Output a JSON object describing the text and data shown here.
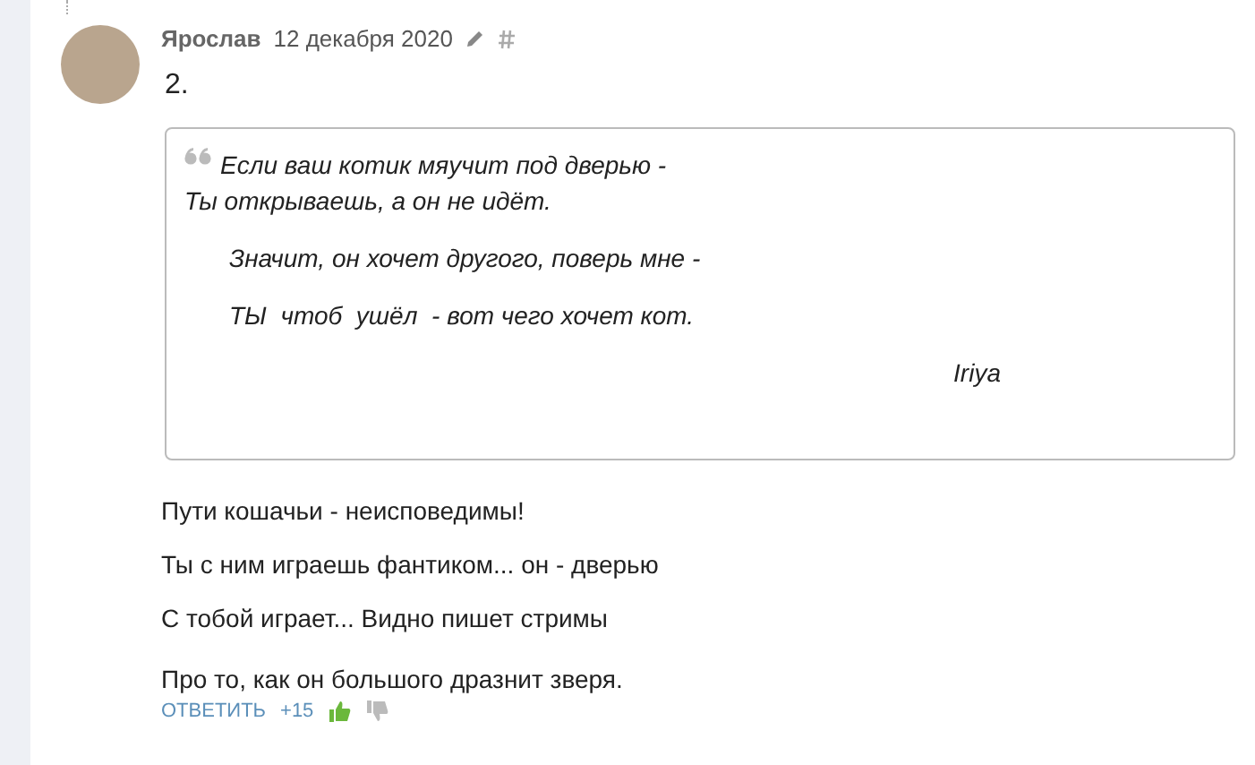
{
  "comment": {
    "author": "Ярослав",
    "date": "12 декабря 2020",
    "number": "2.",
    "quote": {
      "lines": [
        {
          "text": "Если ваш котик мяучит под дверью -",
          "kind": "first"
        },
        {
          "text": "Ты открываешь, а он не идёт.",
          "kind": "plain"
        },
        {
          "text": "Значит, он хочет другого, поверь мне -",
          "kind": "indent"
        },
        {
          "text": "ТЫ  чтоб  ушёл  - вот чего хочет кот.",
          "kind": "indent"
        }
      ],
      "signature": "Iriya"
    },
    "paragraphs": [
      "Пути кошачьи - неисповедимы!",
      "Ты с ним играешь фантиком... он - дверью",
      "С тобой играет... Видно пишет стримы",
      "Про то, как он большого дразнит зверя."
    ],
    "actions": {
      "reply": "ОТВЕТИТЬ",
      "score": "+15"
    }
  }
}
